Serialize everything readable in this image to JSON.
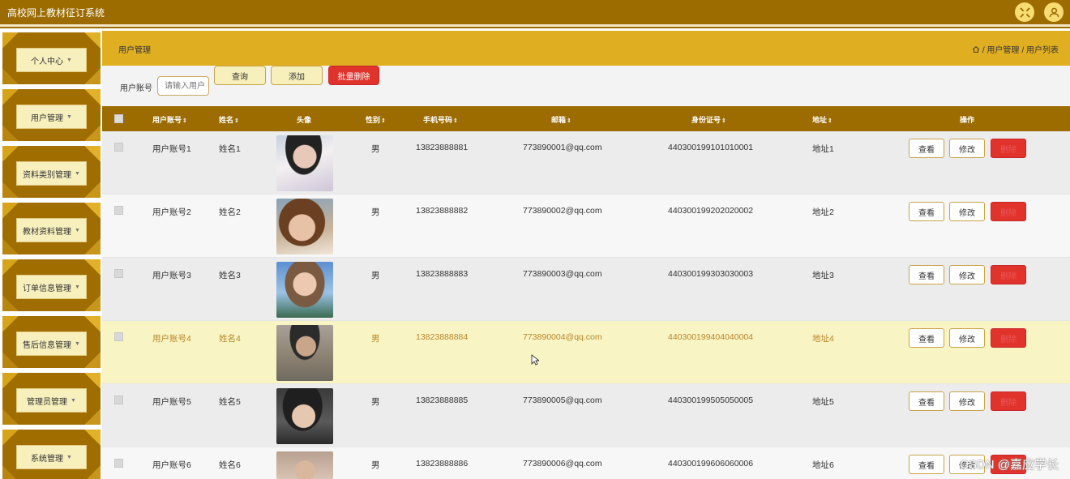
{
  "app": {
    "title": "高校网上教材征订系统"
  },
  "sidebar": {
    "items": [
      {
        "label": "个人中心"
      },
      {
        "label": "用户管理"
      },
      {
        "label": "资料类别管理"
      },
      {
        "label": "教材资料管理"
      },
      {
        "label": "订单信息管理"
      },
      {
        "label": "售后信息管理"
      },
      {
        "label": "管理员管理"
      },
      {
        "label": "系统管理"
      }
    ]
  },
  "header": {
    "page_title": "用户管理",
    "breadcrumb": [
      "/ 用户管理",
      "/ 用户列表"
    ]
  },
  "search": {
    "label": "用户账号",
    "placeholder": "请输入用户",
    "query_label": "查询",
    "add_label": "添加",
    "batch_delete_label": "批量删除"
  },
  "table": {
    "columns": [
      "用户账号",
      "姓名",
      "头像",
      "性别",
      "手机号码",
      "邮箱",
      "身份证号",
      "地址",
      "操作"
    ],
    "sort_icon": "⇕",
    "actions": {
      "view": "查看",
      "edit": "修改",
      "delete": "删除"
    },
    "rows": [
      {
        "account": "用户账号1",
        "name": "姓名1",
        "gender": "男",
        "phone": "13823888881",
        "email": "773890001@qq.com",
        "id_card": "440300199101010001",
        "address": "地址1"
      },
      {
        "account": "用户账号2",
        "name": "姓名2",
        "gender": "男",
        "phone": "13823888882",
        "email": "773890002@qq.com",
        "id_card": "440300199202020002",
        "address": "地址2"
      },
      {
        "account": "用户账号3",
        "name": "姓名3",
        "gender": "男",
        "phone": "13823888883",
        "email": "773890003@qq.com",
        "id_card": "440300199303030003",
        "address": "地址3"
      },
      {
        "account": "用户账号4",
        "name": "姓名4",
        "gender": "男",
        "phone": "13823888884",
        "email": "773890004@qq.com",
        "id_card": "440300199404040004",
        "address": "地址4"
      },
      {
        "account": "用户账号5",
        "name": "姓名5",
        "gender": "男",
        "phone": "13823888885",
        "email": "773890005@qq.com",
        "id_card": "440300199505050005",
        "address": "地址5"
      },
      {
        "account": "用户账号6",
        "name": "姓名6",
        "gender": "男",
        "phone": "13823888886",
        "email": "773890006@qq.com",
        "id_card": "440300199606060006",
        "address": "地址6"
      }
    ]
  },
  "watermark": "CSDN @嘉应学长",
  "colors": {
    "topbar": "#9c6c00",
    "accent": "#e0ae21",
    "danger": "#e0332b",
    "highlight_row": "#f9f4c4"
  },
  "icons": {
    "top_left": "fullscreen-icon",
    "top_right": "user-icon",
    "breadcrumb": "home-icon"
  }
}
